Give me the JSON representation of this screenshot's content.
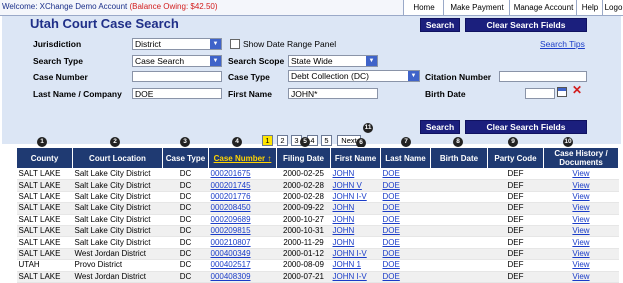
{
  "topbar": {
    "welcome": "Welcome: XChange Demo Account",
    "owing": "(Balance Owing: $42.50)",
    "nav": [
      "Home",
      "Make Payment",
      "Manage Account",
      "Help",
      "Logo"
    ]
  },
  "page_title": "Utah Court Case Search",
  "buttons": {
    "search": "Search",
    "clear": "Clear Search Fields"
  },
  "form": {
    "jurisdiction_label": "Jurisdiction",
    "jurisdiction_value": "District",
    "date_range_label": "Show Date Range Panel",
    "search_tips": "Search Tips",
    "search_type_label": "Search Type",
    "search_type_value": "Case Search",
    "search_scope_label": "Search Scope",
    "search_scope_value": "State Wide",
    "case_number_label": "Case Number",
    "case_number_value": "",
    "case_type_label": "Case Type",
    "case_type_value": "Debt Collection (DC)",
    "citation_label": "Citation Number",
    "citation_value": "",
    "last_name_label": "Last Name / Company",
    "last_name_value": "DOE",
    "first_name_label": "First Name",
    "first_name_value": "JOHN*",
    "birth_date_label": "Birth Date",
    "birth_date_value": ""
  },
  "pager": {
    "pages": [
      "1",
      "2",
      "3",
      "4",
      "5"
    ],
    "current": "1",
    "next": "Next"
  },
  "markers": [
    "1",
    "2",
    "3",
    "4",
    "5",
    "6",
    "7",
    "8",
    "9",
    "10",
    "11"
  ],
  "colors": {
    "header_bg": "#1f3a72",
    "button_bg": "#1b1f7d",
    "link": "#1a3cc8",
    "owing": "#d21c1c"
  },
  "table": {
    "columns": [
      "County",
      "Court Location",
      "Case Type",
      "Case Number ↑",
      "Filing Date",
      "First Name",
      "Last Name",
      "Birth Date",
      "Party Code",
      "Case History / Documents"
    ],
    "rows": [
      [
        "SALT LAKE",
        "Salt Lake City District",
        "DC",
        "000201675",
        "2000-02-25",
        "JOHN",
        "DOE",
        "",
        "DEF",
        "View"
      ],
      [
        "SALT LAKE",
        "Salt Lake City District",
        "DC",
        "000201745",
        "2000-02-28",
        "JOHN V",
        "DOE",
        "",
        "DEF",
        "View"
      ],
      [
        "SALT LAKE",
        "Salt Lake City District",
        "DC",
        "000201776",
        "2000-02-28",
        "JOHN I-V",
        "DOE",
        "",
        "DEF",
        "View"
      ],
      [
        "SALT LAKE",
        "Salt Lake City District",
        "DC",
        "000208450",
        "2000-09-22",
        "JOHN",
        "DOE",
        "",
        "DEF",
        "View"
      ],
      [
        "SALT LAKE",
        "Salt Lake City District",
        "DC",
        "000209689",
        "2000-10-27",
        "JOHN",
        "DOE",
        "",
        "DEF",
        "View"
      ],
      [
        "SALT LAKE",
        "Salt Lake City District",
        "DC",
        "000209815",
        "2000-10-31",
        "JOHN",
        "DOE",
        "",
        "DEF",
        "View"
      ],
      [
        "SALT LAKE",
        "Salt Lake City District",
        "DC",
        "000210807",
        "2000-11-29",
        "JOHN",
        "DOE",
        "",
        "DEF",
        "View"
      ],
      [
        "SALT LAKE",
        "West Jordan District",
        "DC",
        "000400349",
        "2000-01-12",
        "JOHN I-V",
        "DOE",
        "",
        "DEF",
        "View"
      ],
      [
        "UTAH",
        "Provo District",
        "DC",
        "000402517",
        "2000-08-09",
        "JOHN 1",
        "DOE",
        "",
        "DEF",
        "View"
      ],
      [
        "SALT LAKE",
        "West Jordan District",
        "DC",
        "000408309",
        "2000-07-21",
        "JOHN I-V",
        "DOE",
        "",
        "DEF",
        "View"
      ]
    ]
  }
}
